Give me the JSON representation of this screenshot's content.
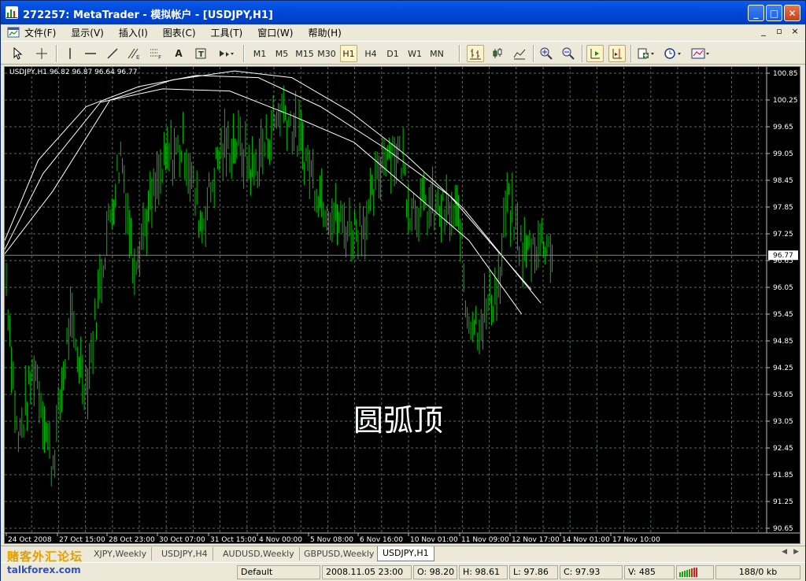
{
  "window": {
    "title": "272257: MetaTrader - 模拟帐户 - [USDJPY,H1]",
    "buttons": [
      "_",
      "□",
      "✕"
    ]
  },
  "menu": {
    "items": [
      "文件(F)",
      "显示(V)",
      "插入(I)",
      "图表(C)",
      "工具(T)",
      "窗口(W)",
      "帮助(H)"
    ],
    "mdi_buttons": [
      "_",
      "▫",
      "×"
    ]
  },
  "toolbar": {
    "timeframes": [
      "M1",
      "M5",
      "M15",
      "M30",
      "H1",
      "H4",
      "D1",
      "W1",
      "MN"
    ],
    "selected_timeframe": "H1",
    "tools": [
      "cursor-icon",
      "crosshair-icon",
      "vertical-line-icon",
      "horizontal-line-icon",
      "trendline-icon",
      "fibonacci-icon",
      "gann-icon",
      "text-icon",
      "label-icon",
      "arrow-icon",
      "bar-chart-icon",
      "candle-chart-icon",
      "line-chart-icon",
      "zoom-in-icon",
      "zoom-out-icon",
      "autoscroll-icon",
      "chart-shift-icon",
      "indicators-icon",
      "periods-icon",
      "templates-icon"
    ]
  },
  "chart": {
    "symbol_info": "USDJPY,H1  96.82 96.87 96.64 96.77",
    "annotation": "圆弧顶",
    "current_price_label": "96.77",
    "background": "#000000",
    "bar_color": "#00c000",
    "grid_color": "#5a6e5a"
  },
  "chart_data": {
    "type": "bar",
    "symbol": "USDJPY",
    "timeframe": "H1",
    "last": 96.77,
    "ylim": [
      90.65,
      100.85
    ],
    "y_ticks": [
      "100.85",
      "100.25",
      "99.65",
      "99.05",
      "98.45",
      "97.85",
      "97.25",
      "96.65",
      "96.05",
      "95.45",
      "94.85",
      "94.25",
      "93.65",
      "93.05",
      "92.45",
      "91.85",
      "91.25",
      "90.65"
    ],
    "x_tick_labels": [
      "24 Oct 2008",
      "27 Oct 15:00",
      "28 Oct 23:00",
      "30 Oct 07:00",
      "31 Oct 15:00",
      "4 Nov 00:00",
      "5 Nov 08:00",
      "6 Nov 16:00",
      "10 Nov 01:00",
      "11 Nov 09:00",
      "12 Nov 17:00",
      "14 Nov 01:00",
      "17 Nov 10:00"
    ],
    "price_path": [
      [
        0,
        96.2
      ],
      [
        0.02,
        92.5
      ],
      [
        0.05,
        94.3
      ],
      [
        0.08,
        92.0
      ],
      [
        0.11,
        95.2
      ],
      [
        0.14,
        93.8
      ],
      [
        0.17,
        96.8
      ],
      [
        0.2,
        99.1
      ],
      [
        0.22,
        96.6
      ],
      [
        0.25,
        97.8
      ],
      [
        0.28,
        98.9
      ],
      [
        0.31,
        99.2
      ],
      [
        0.34,
        97.4
      ],
      [
        0.37,
        99.0
      ],
      [
        0.4,
        99.3
      ],
      [
        0.43,
        98.6
      ],
      [
        0.46,
        99.5
      ],
      [
        0.48,
        100.1
      ],
      [
        0.51,
        99.3
      ],
      [
        0.54,
        98.3
      ],
      [
        0.57,
        97.6
      ],
      [
        0.6,
        97.3
      ],
      [
        0.63,
        97.6
      ],
      [
        0.66,
        99.2
      ],
      [
        0.69,
        98.9
      ],
      [
        0.7,
        97.9
      ],
      [
        0.73,
        97.8
      ],
      [
        0.76,
        97.7
      ],
      [
        0.79,
        97.5
      ],
      [
        0.8,
        95.5
      ],
      [
        0.82,
        95.2
      ],
      [
        0.84,
        95.6
      ],
      [
        0.86,
        96.2
      ],
      [
        0.87,
        98.0
      ],
      [
        0.9,
        96.8
      ],
      [
        0.92,
        97.0
      ],
      [
        0.94,
        97.1
      ],
      [
        0.95,
        96.8
      ]
    ],
    "moving_averages": [
      {
        "points": [
          [
            0,
            96.9
          ],
          [
            0.08,
            98.6
          ],
          [
            0.2,
            100.2
          ],
          [
            0.33,
            100.5
          ],
          [
            0.47,
            100.45
          ],
          [
            0.6,
            99.9
          ],
          [
            0.73,
            99.3
          ],
          [
            0.85,
            98.2
          ],
          [
            0.97,
            97.1
          ],
          [
            1.08,
            95.45
          ]
        ]
      },
      {
        "points": [
          [
            0,
            97.1
          ],
          [
            0.07,
            98.9
          ],
          [
            0.17,
            100.1
          ],
          [
            0.28,
            100.55
          ],
          [
            0.4,
            100.8
          ],
          [
            0.53,
            100.75
          ],
          [
            0.66,
            100.1
          ],
          [
            0.79,
            99.2
          ],
          [
            0.93,
            98.1
          ],
          [
            1.1,
            96.0
          ]
        ]
      },
      {
        "points": [
          [
            0,
            96.8
          ],
          [
            0.1,
            98.2
          ],
          [
            0.22,
            100.25
          ],
          [
            0.35,
            100.7
          ],
          [
            0.48,
            100.9
          ],
          [
            0.6,
            100.75
          ],
          [
            0.72,
            100.0
          ],
          [
            0.84,
            99.0
          ],
          [
            0.96,
            97.8
          ],
          [
            1.12,
            95.7
          ]
        ]
      }
    ],
    "grid": true
  },
  "tabs": {
    "items": [
      "XJPY,Weekly",
      "USDJPY,H4",
      "AUDUSD,Weekly",
      "GBPUSD,Weekly",
      "USDJPY,H1"
    ],
    "active": "USDJPY,H1"
  },
  "status": {
    "profile": "Default",
    "datetime": "2008.11.05 23:00",
    "open": "O: 98.20",
    "high": "H: 98.61",
    "low": "L: 97.86",
    "close": "C: 97.93",
    "volume": "V: 485",
    "traffic": "188/0 kb"
  },
  "watermark": {
    "cn": "赌客外汇论坛",
    "en": "talkforex.com"
  }
}
